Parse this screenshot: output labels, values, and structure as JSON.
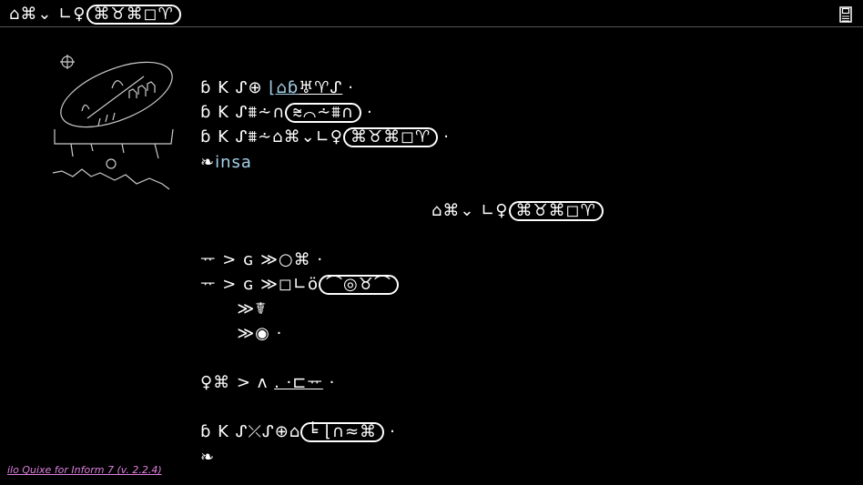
{
  "header": {
    "room_a": "⌂⌘⌄ ∟♀",
    "room_b": "⌘♉⌘◻♈",
    "save_icon": "floppy-disk-icon"
  },
  "scene": {
    "line1_prefix": "ɓ K ᔑ⊕ ",
    "line1_link": "⌊⌂ɓ",
    "line1_word": "♅♈ᔑ",
    "line1_end": "·",
    "line2_prefix": "ɓ K ᔑ⩩⩪∩",
    "line2_cart": "⩬⌒⩪⩩∩",
    "line2_end": "·",
    "line3_prefix": "ɓ K ᔑ⩩⩪⌂⌘⌄∟♀",
    "line3_cart": "⌘♉⌘◻♈",
    "line3_end": "·"
  },
  "status": {
    "symbol": "❧",
    "word": "insa"
  },
  "centered": {
    "text": "⌂⌘⌄ ∟♀",
    "cart": "⌘♉⌘◻♈"
  },
  "response": {
    "l1": "ᅲ > ɢ ≫○⌘ ·",
    "l2_prefix": "ᅲ > ɢ ≫◻∟ö",
    "l2_cart": "⌒◎♉⌒",
    "l3": "      ≫☤",
    "l4": "      ≫◉ ·",
    "l5_prefix": "♀⌘ > ʌ ",
    "l5_link": ". ·⊏ᅲ",
    "l5_end": " ·",
    "l6_prefix": "ɓ K ᔑ⤫ᔑ⊕⌂",
    "l6_cart": "╘ ⌊∩≈⌘",
    "l6_end": "·"
  },
  "prompt": {
    "symbol": "❧"
  },
  "footer": {
    "credit": "ilo Quixe for Inform 7 (v. 2.2.4)"
  }
}
